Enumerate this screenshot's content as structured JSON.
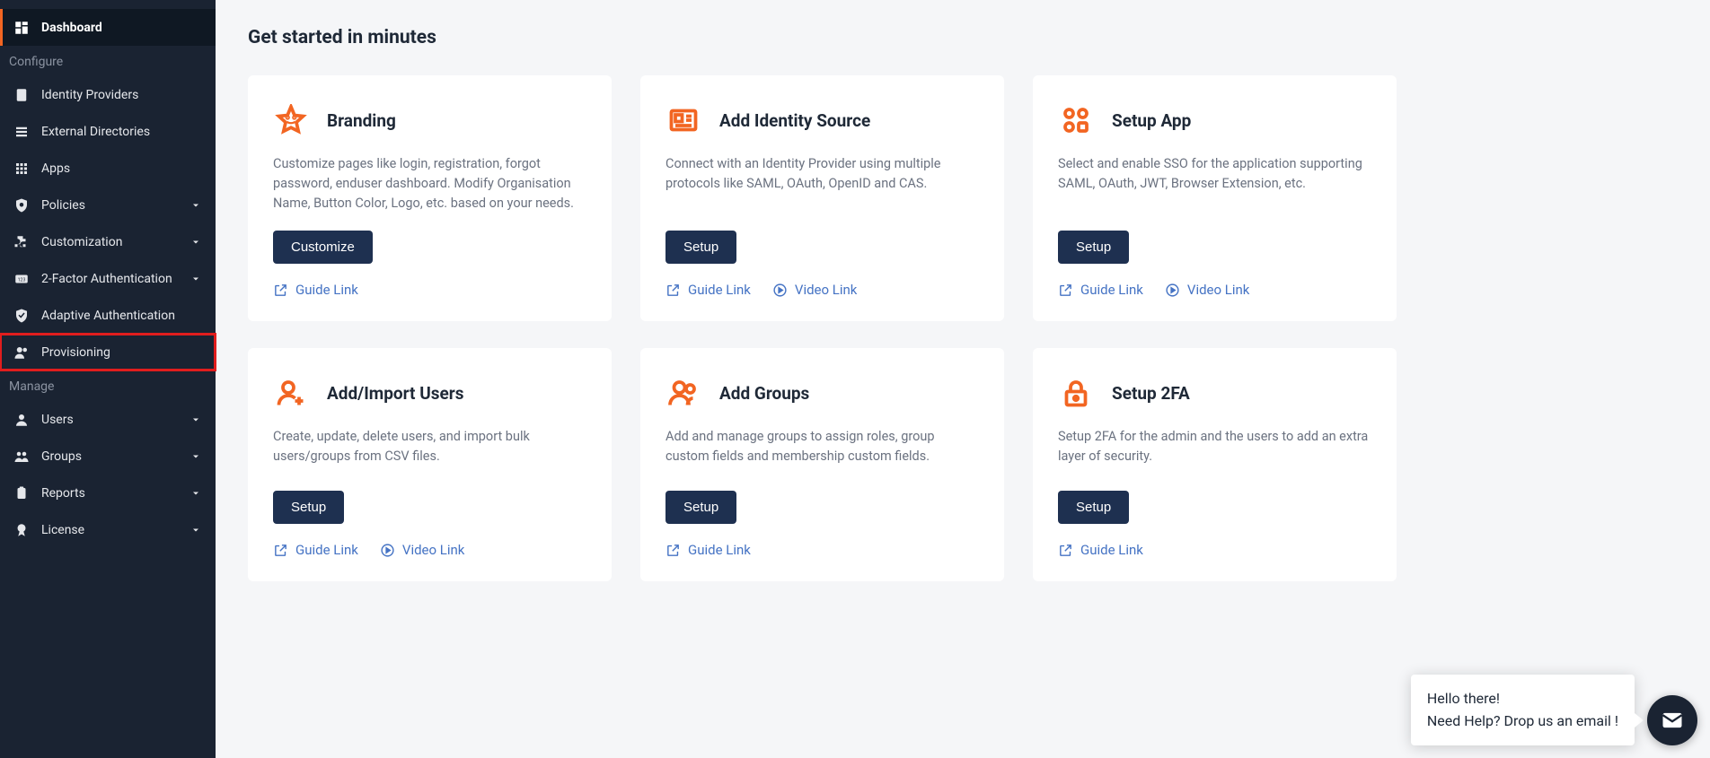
{
  "sidebar": {
    "dashboard": "Dashboard",
    "section_configure": "Configure",
    "section_manage": "Manage",
    "items_configure": [
      {
        "label": "Identity Providers",
        "icon": "id-badge"
      },
      {
        "label": "External Directories",
        "icon": "list"
      },
      {
        "label": "Apps",
        "icon": "grid"
      },
      {
        "label": "Policies",
        "icon": "gear-shield",
        "expandable": true
      },
      {
        "label": "Customization",
        "icon": "puzzle",
        "expandable": true
      },
      {
        "label": "2-Factor Authentication",
        "icon": "code-box",
        "expandable": true
      },
      {
        "label": "Adaptive Authentication",
        "icon": "shield-check"
      },
      {
        "label": "Provisioning",
        "icon": "users-gear",
        "highlighted": true
      }
    ],
    "items_manage": [
      {
        "label": "Users",
        "icon": "user",
        "expandable": true
      },
      {
        "label": "Groups",
        "icon": "users",
        "expandable": true
      },
      {
        "label": "Reports",
        "icon": "clipboard",
        "expandable": true
      },
      {
        "label": "License",
        "icon": "award",
        "expandable": true
      }
    ]
  },
  "page": {
    "title": "Get started in minutes"
  },
  "links": {
    "guide": "Guide Link",
    "video": "Video Link"
  },
  "chat": {
    "line1": "Hello there!",
    "line2": "Need Help? Drop us an email !"
  },
  "cards": [
    {
      "title": "Branding",
      "desc": "Customize pages like login, registration, forgot password, enduser dashboard. Modify Organisation Name, Button Color, Logo, etc. based on your needs.",
      "button": "Customize",
      "icon": "star",
      "guide": true,
      "video": false
    },
    {
      "title": "Add Identity Source",
      "desc": "Connect with an Identity Provider using multiple protocols like SAML, OAuth, OpenID and CAS.",
      "button": "Setup",
      "icon": "id-card",
      "guide": true,
      "video": true
    },
    {
      "title": "Setup App",
      "desc": "Select and enable SSO for the application supporting SAML, OAuth, JWT, Browser Extension, etc.",
      "button": "Setup",
      "icon": "apps",
      "guide": true,
      "video": true
    },
    {
      "title": "Add/Import Users",
      "desc": "Create, update, delete users, and import bulk users/groups from CSV files.",
      "button": "Setup",
      "icon": "user-plus",
      "guide": true,
      "video": true
    },
    {
      "title": "Add Groups",
      "desc": "Add and manage groups to assign roles, group custom fields and membership custom fields.",
      "button": "Setup",
      "icon": "users",
      "guide": true,
      "video": false
    },
    {
      "title": "Setup 2FA",
      "desc": "Setup 2FA for the admin and the users to add an extra layer of security.",
      "button": "Setup",
      "icon": "lock",
      "guide": true,
      "video": false
    }
  ]
}
